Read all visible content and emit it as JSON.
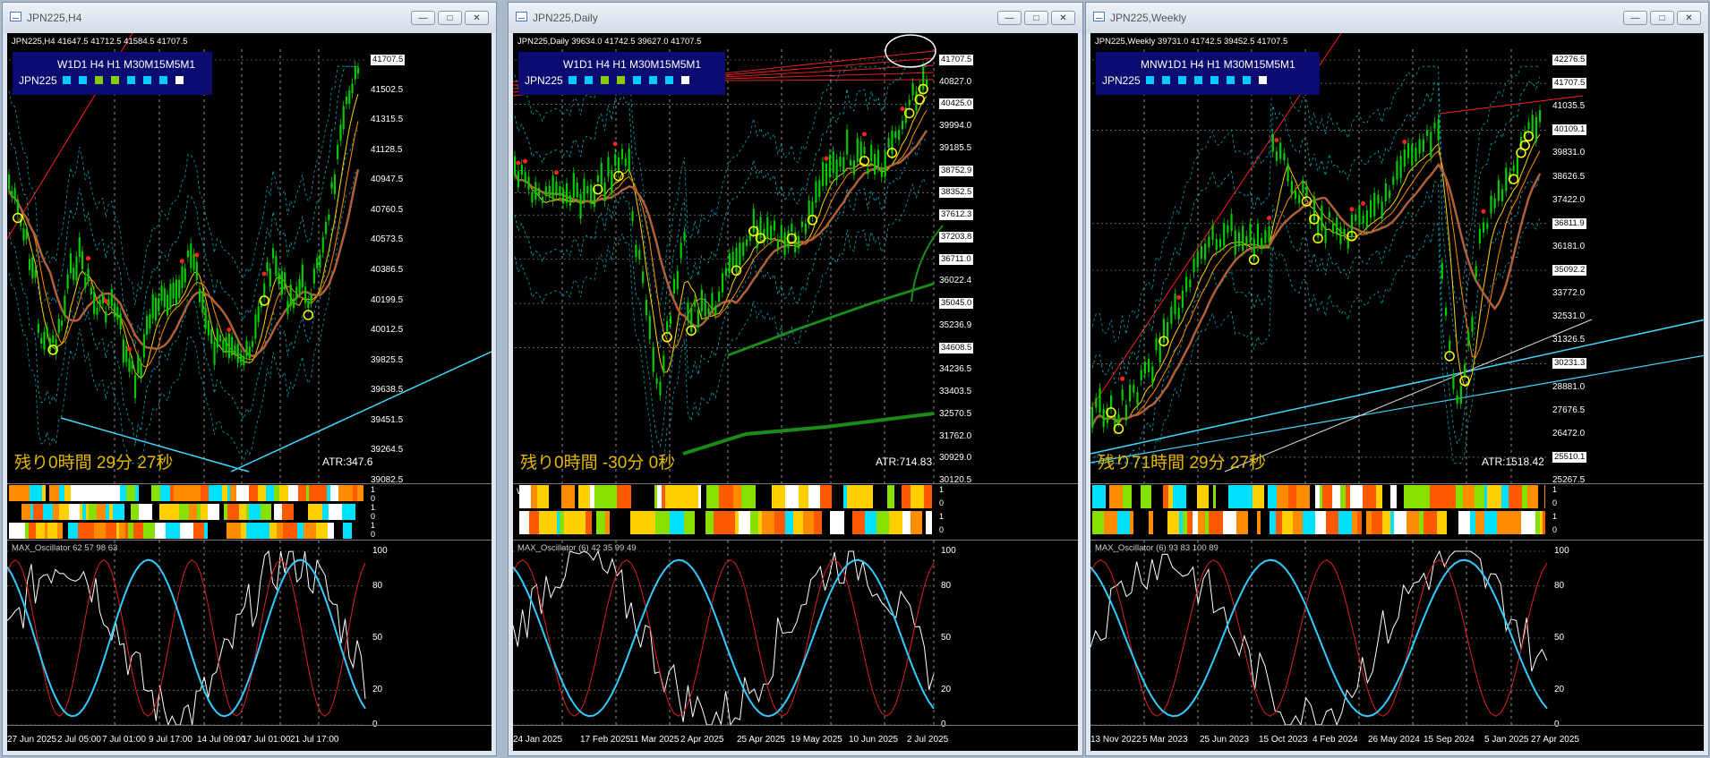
{
  "windows": [
    {
      "id": "h4",
      "title": "JPN225,H4",
      "header": "JPN225,H4  41647.5 41712.5 41584.5 41707.5",
      "panel": {
        "symbol": "JPN225",
        "timeframes": "W1D1 H4 H1 M30M15M5M1",
        "squares": [
          "#00ccff",
          "#00ccff",
          "#88cc00",
          "#88cc00",
          "#00ccff",
          "#00ccff",
          "#00ccff",
          "#ffffff"
        ]
      },
      "prices": [
        "41707.5",
        "41502.5",
        "41315.5",
        "41128.5",
        "40947.5",
        "40760.5",
        "40573.5",
        "40386.5",
        "40199.5",
        "40012.5",
        "39825.5",
        "39638.5",
        "39451.5",
        "39264.5",
        "39082.5"
      ],
      "remaining": "残り0時間 29分 27秒",
      "atr": "ATR:347.6",
      "oscillator": "MAX_Oscillator 62 57 98 63",
      "osc_levels": [
        "100",
        "80",
        "50",
        "20",
        "0"
      ],
      "strip_labels": [
        "1",
        "0",
        "1",
        "0",
        "1",
        "0"
      ],
      "dates": [
        "27 Jun 2025",
        "2 Jul 05:00",
        "7 Jul 01:00",
        "9 Jul 17:00",
        "14 Jul 09:00",
        "17 Jul 01:00",
        "21 Jul 17:00"
      ],
      "w1_label": ""
    },
    {
      "id": "d1",
      "title": "JPN225,Daily",
      "header": "JPN225,Daily  39634.0 41742.5 39627.0 41707.5",
      "panel": {
        "symbol": "JPN225",
        "timeframes": "W1D1 H4 H1 M30M15M5M1",
        "squares": [
          "#00ccff",
          "#00ccff",
          "#88cc00",
          "#88cc00",
          "#00ccff",
          "#00ccff",
          "#00ccff",
          "#ffffff"
        ]
      },
      "prices": [
        "41707.5",
        "40827.0",
        "40425.0",
        "39994.0",
        "39185.5",
        "38752.9",
        "38352.5",
        "37612.3",
        "37203.8",
        "36711.0",
        "36022.4",
        "35045.0",
        "35236.9",
        "34608.5",
        "34236.5",
        "33403.5",
        "32570.5",
        "31762.0",
        "30929.0",
        "30120.5"
      ],
      "remaining": "残り0時間 -30分 0秒",
      "atr": "ATR:714.83",
      "oscillator": "MAX_Oscillator (6) 42 35 99 49",
      "osc_levels": [
        "100",
        "80",
        "50",
        "20",
        "0"
      ],
      "strip_labels": [
        "1",
        "0",
        "1",
        "0"
      ],
      "dates": [
        "24 Jan 2025",
        "17 Feb 2025",
        "11 Mar 2025",
        "2 Apr 2025",
        "25 Apr 2025",
        "19 May 2025",
        "10 Jun 2025",
        "2 Jul 2025"
      ],
      "w1_label": "W1"
    },
    {
      "id": "w1",
      "title": "JPN225,Weekly",
      "header": "JPN225,Weekly  39731.0 41742.5 39452.5 41707.5",
      "panel": {
        "symbol": "JPN225",
        "timeframes": "MNW1D1 H4 H1 M30M15M5M1",
        "squares": [
          "#00ccff",
          "#00ccff",
          "#00ccff",
          "#00ccff",
          "#00ccff",
          "#00ccff",
          "#00ccff",
          "#ffffff"
        ]
      },
      "prices": [
        "42276.5",
        "41707.5",
        "41035.5",
        "40109.1",
        "39831.0",
        "38626.5",
        "37422.0",
        "36811.9",
        "36181.0",
        "35092.2",
        "33772.0",
        "32531.0",
        "31326.5",
        "30231.3",
        "28881.0",
        "27676.5",
        "26472.0",
        "25510.1",
        "25267.5"
      ],
      "remaining": "残り71時間 29分 27秒",
      "atr": "ATR:1518.42",
      "oscillator": "MAX_Oscillator (6) 93 83 100 89",
      "osc_levels": [
        "100",
        "80",
        "50",
        "20",
        "0"
      ],
      "strip_labels": [
        "1",
        "0",
        "1",
        "0"
      ],
      "dates": [
        "13 Nov 2022",
        "5 Mar 2023",
        "25 Jun 2023",
        "15 Oct 2023",
        "4 Feb 2024",
        "26 May 2024",
        "15 Sep 2024",
        "5 Jan 2025",
        "27 Apr 2025"
      ],
      "w1_label": ""
    }
  ],
  "colors": {
    "candle": "#00cc00",
    "band": "#00cccc",
    "trend_red": "#ff2020",
    "signal_yellow": "#ffff00",
    "ma_brown": "#b0603a",
    "osc_red": "#dd2020",
    "osc_cyan": "#33ccff"
  },
  "window_buttons": {
    "minimize": "—",
    "maximize": "□",
    "close": "✕"
  }
}
